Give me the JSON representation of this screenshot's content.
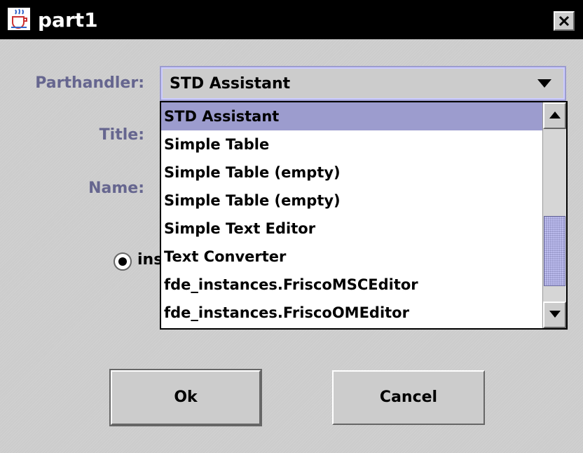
{
  "window": {
    "title": "part1",
    "icon": "java-cup-icon",
    "close_icon": "close-x-icon"
  },
  "form": {
    "parthandler_label": "Parthandler:",
    "title_label": "Title:",
    "name_label": "Name:"
  },
  "combo": {
    "selected": "STD Assistant",
    "options": [
      "STD Assistant",
      "Simple Table",
      "Simple Table (empty)",
      "Simple Table (empty)",
      "Simple Text Editor",
      "Text Converter",
      "fde_instances.FriscoMSCEditor",
      "fde_instances.FriscoOMEditor"
    ]
  },
  "radio": {
    "label_visible": "ins",
    "checked": true
  },
  "buttons": {
    "ok": "Ok",
    "cancel": "Cancel"
  },
  "colors": {
    "label_text": "#66668f",
    "selection": "#9c9cce",
    "background": "#cccccc"
  }
}
